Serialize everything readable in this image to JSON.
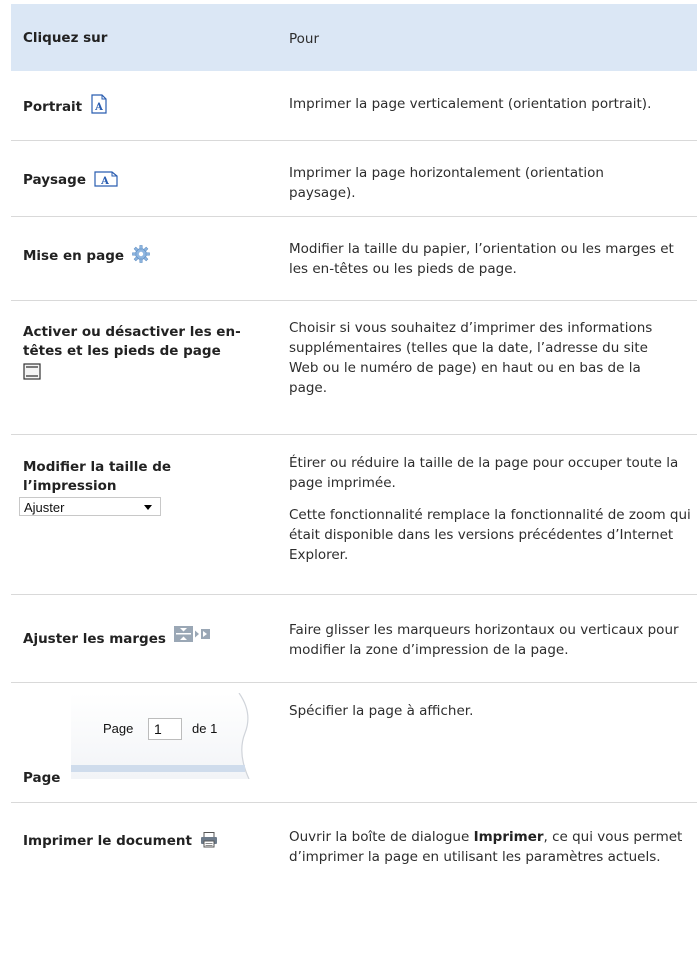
{
  "header": {
    "col1": "Cliquez sur",
    "col2": "Pour"
  },
  "rows": {
    "portrait": {
      "label": "Portrait",
      "desc": "Imprimer la page verticalement (orientation portrait)."
    },
    "paysage": {
      "label": "Paysage",
      "desc": "Imprimer la page horizontalement (orientation paysage)."
    },
    "mise_en_page": {
      "label": "Mise en page",
      "desc": "Modifier la taille du papier, l’orientation ou les marges et les en-têtes ou les pieds de page."
    },
    "entetes": {
      "label": "Activer ou désactiver les en-têtes et les pieds de page",
      "desc": "Choisir si vous souhaitez d’imprimer des informations supplémentaires (telles que la date, l’adresse du site Web ou le numéro de page) en haut ou en bas de la page."
    },
    "taille": {
      "label": "Modifier la taille de l’impression",
      "select_value": "Ajuster",
      "desc1": "Étirer ou réduire la taille de la page pour occuper toute la page imprimée.",
      "desc2": "Cette fonctionnalité remplace la fonctionnalité de zoom qui était disponible dans les versions précédentes d’Internet Explorer."
    },
    "marges": {
      "label": "Ajuster les marges",
      "desc": "Faire glisser les marqueurs horizontaux ou verticaux pour modifier la zone d’impression de la page."
    },
    "page": {
      "label": "Page",
      "pager_prefix": "Page",
      "pager_value": "1",
      "pager_suffix": "de 1",
      "desc": "Spécifier la page à afficher."
    },
    "imprimer": {
      "label": "Imprimer le document",
      "desc_before": "Ouvrir la boîte de dialogue ",
      "desc_bold": "Imprimer",
      "desc_after": ", ce qui vous permet d’imprimer la page en utilisant les paramètres actuels."
    }
  },
  "icons": {
    "portrait": "portrait-icon",
    "paysage": "landscape-icon",
    "mise_en_page": "gear-icon",
    "entetes": "header-footer-icon",
    "marges": "margins-icon",
    "imprimer": "printer-icon"
  },
  "colors": {
    "header_bg": "#dbe7f5",
    "icon_blue": "#2a5db0"
  }
}
